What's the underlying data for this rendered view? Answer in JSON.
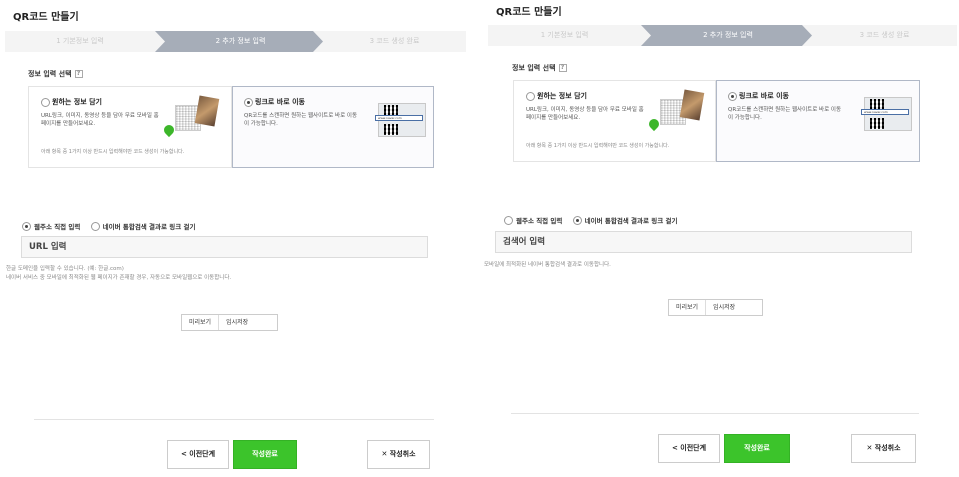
{
  "title": "QR코드 만들기",
  "steps": [
    "1 기본정보 입력",
    "2 추가 정보 입력",
    "3 코드 생성 완료"
  ],
  "section_label": "정보 입력 선택",
  "help_icon": "?",
  "cards": {
    "info": {
      "title": "원하는 정보 담기",
      "desc": "URL링크, 이미지, 동영상 등을 담아 무료 모바일 홈페이지를 만들어보세요.",
      "note": "아래 항목 중 1가지 이상 반드시 입력해야만 코드 생성이 가능합니다."
    },
    "link": {
      "title": "링크로 바로 이동",
      "desc": "QR코드를 스캔하면 원하는 웹사이트로 바로 이동이 가능합니다.",
      "url_text": "www.naver.com"
    }
  },
  "link_options": {
    "direct": "웹주소 직접 입력",
    "search": "네이버 통합검색 결과로 링크 걸기"
  },
  "left": {
    "input_value": "URL 입력",
    "hint1": "한글 도메인을 입력할 수 있습니다. (예: 한글.com)",
    "hint2": "네이버 서비스 중 모바일에 최적화된 웹 페이지가 존재할 경우, 자동으로 모바일웹으로 이동합니다."
  },
  "right": {
    "input_value": "검색어 입력",
    "hint1": "모바일에 최적화된 네이버 통합검색 결과로 이동합니다."
  },
  "preview": "미리보기",
  "temp_save": "임시저장",
  "prev": "< 이전단계",
  "done": "작성완료",
  "cancel": "✕ 작성취소",
  "colors": {
    "accent_green": "#3cc42b",
    "step_active": "#a6adb8"
  }
}
